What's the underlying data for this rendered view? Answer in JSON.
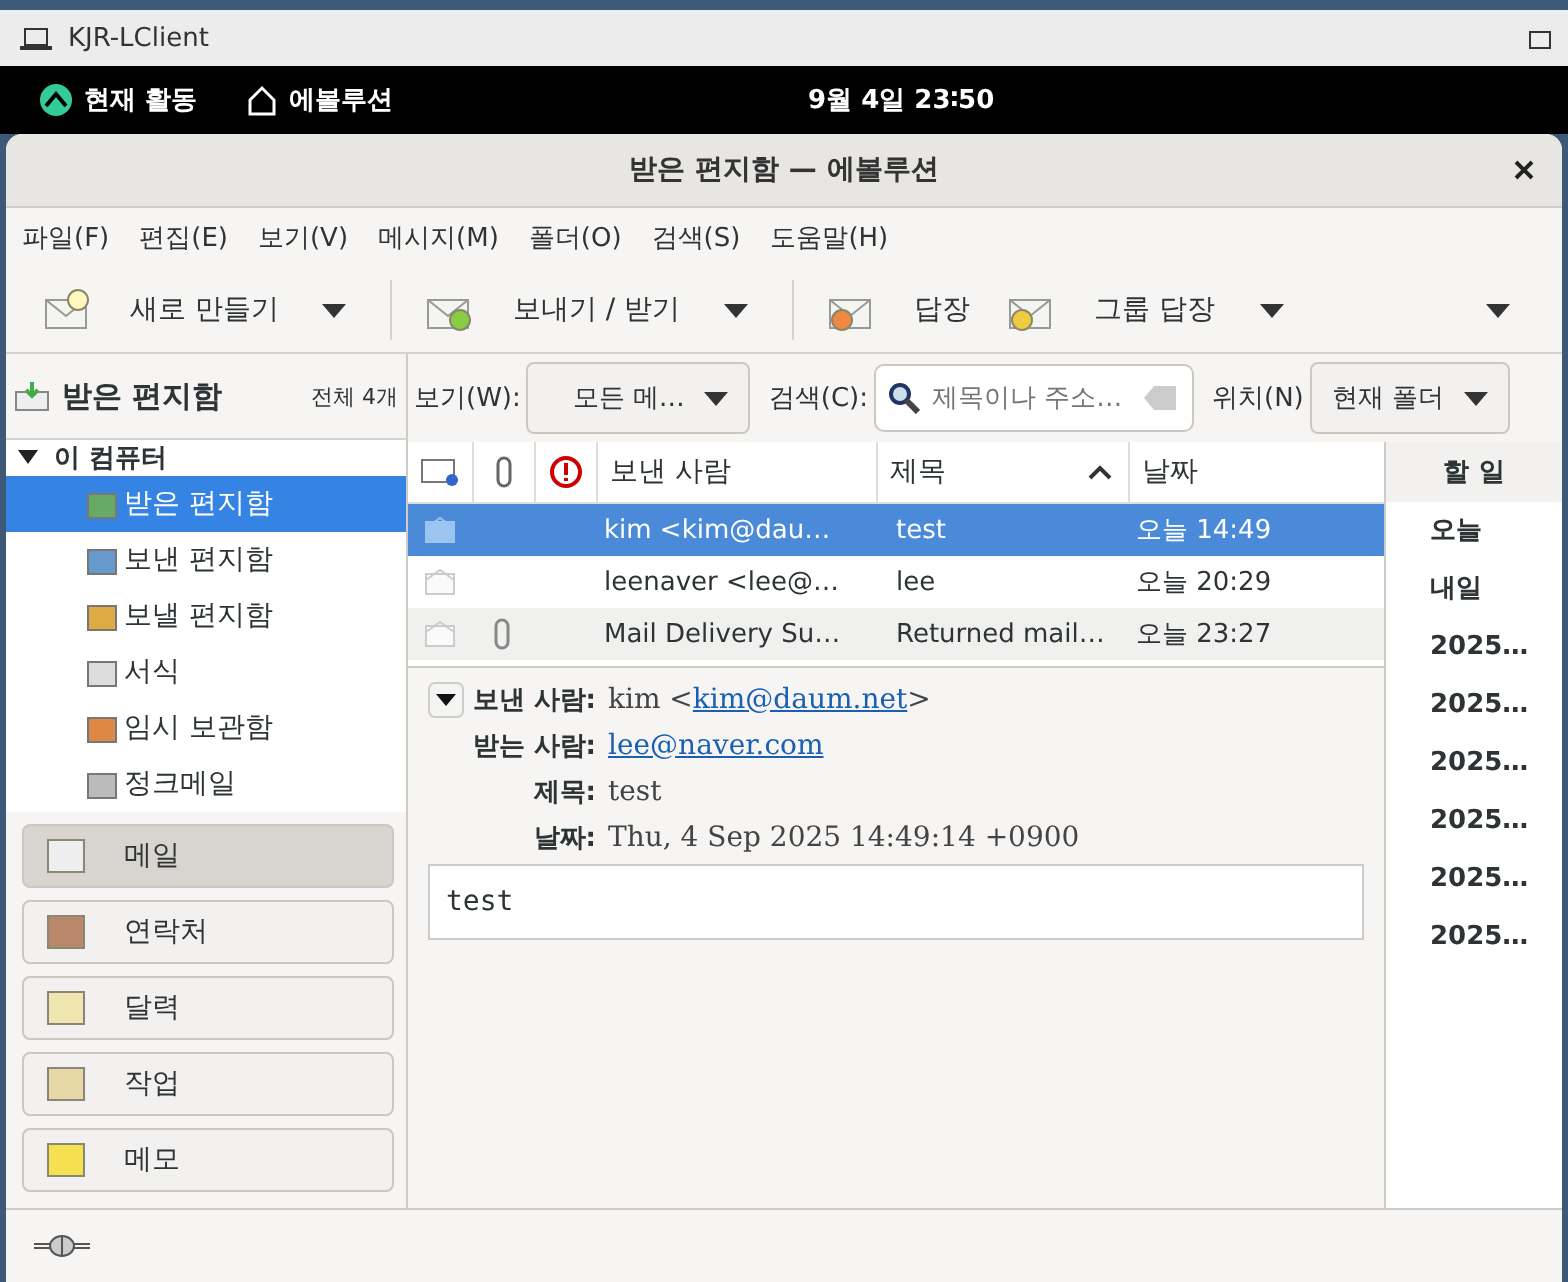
{
  "host_window": {
    "title": "KJR-LClient"
  },
  "top_bar": {
    "activities": "현재 활동",
    "app": "에볼루션",
    "clock": "9월 4일  23∶50"
  },
  "window": {
    "title": "받은 편지함 — 에볼루션"
  },
  "menu": [
    "파일(F)",
    "편집(E)",
    "보기(V)",
    "메시지(M)",
    "폴더(O)",
    "검색(S)",
    "도움말(H)"
  ],
  "toolbar": [
    {
      "label": "새로 만들기",
      "kind": "new",
      "dropdown": true
    },
    {
      "label": "보내기 / 받기",
      "kind": "send_receive",
      "dropdown": true
    },
    {
      "label": "답장",
      "kind": "reply",
      "dropdown": false
    },
    {
      "label": "그룹 답장",
      "kind": "reply_group",
      "dropdown": true
    }
  ],
  "folder_header": {
    "title": "받은 편지함",
    "count": "전체 4개"
  },
  "folders": {
    "label": "이 컴퓨터",
    "expanded": true,
    "children": [
      {
        "label": "받은 편지함",
        "kind": "inbox",
        "selected": true
      },
      {
        "label": "보낸 편지함",
        "kind": "sent",
        "selected": false
      },
      {
        "label": "보낼 편지함",
        "kind": "outbox",
        "selected": false
      },
      {
        "label": "서식",
        "kind": "templates",
        "selected": false
      },
      {
        "label": "임시 보관함",
        "kind": "drafts",
        "selected": false
      },
      {
        "label": "정크메일",
        "kind": "junk",
        "selected": false
      }
    ]
  },
  "switcher": [
    {
      "label": "메일",
      "kind": "mail",
      "selected": true
    },
    {
      "label": "연락처",
      "kind": "contacts",
      "selected": false
    },
    {
      "label": "달력",
      "kind": "calendar",
      "selected": false
    },
    {
      "label": "작업",
      "kind": "tasks",
      "selected": false
    },
    {
      "label": "메모",
      "kind": "memos",
      "selected": false
    }
  ],
  "filter": {
    "view_label": "보기(W):",
    "view_value": "모든 메…",
    "search_label": "검색(C):",
    "search_placeholder": "제목이나 주소…",
    "scope_label": "위치(N)",
    "scope_value": "현재 폴더"
  },
  "message_list": {
    "columns": [
      {
        "label": "보낸 사람",
        "sorted": false
      },
      {
        "label": "제목",
        "sorted": true
      },
      {
        "label": "날짜",
        "sorted": false
      }
    ],
    "rows": [
      {
        "from": "kim <kim@dau…",
        "subject": "test",
        "date": "오늘 14:49",
        "selected": true,
        "attachment": false
      },
      {
        "from": "leenaver <lee@…",
        "subject": "lee",
        "date": "오늘 20:29",
        "selected": false,
        "attachment": false
      },
      {
        "from": "Mail Delivery Su…",
        "subject": "Returned mail…",
        "date": "오늘 23:27",
        "selected": false,
        "attachment": true
      }
    ]
  },
  "preview": {
    "expanded": true,
    "headers": [
      {
        "label": "보낸 사람:",
        "prefix": "kim <",
        "link": "kim@daum.net",
        "suffix": ">"
      },
      {
        "label": "받는 사람:",
        "link": "lee@naver.com"
      },
      {
        "label": "제목:",
        "prefix": "test"
      },
      {
        "label": "날짜:",
        "prefix": "Thu, 4 Sep 2025 14:49:14 +0900"
      }
    ],
    "body": "test"
  },
  "todo": {
    "title": "할 일",
    "items": [
      "오늘",
      "내일",
      "2025…",
      "2025…",
      "2025…",
      "2025…",
      "2025…",
      "2025…"
    ]
  }
}
